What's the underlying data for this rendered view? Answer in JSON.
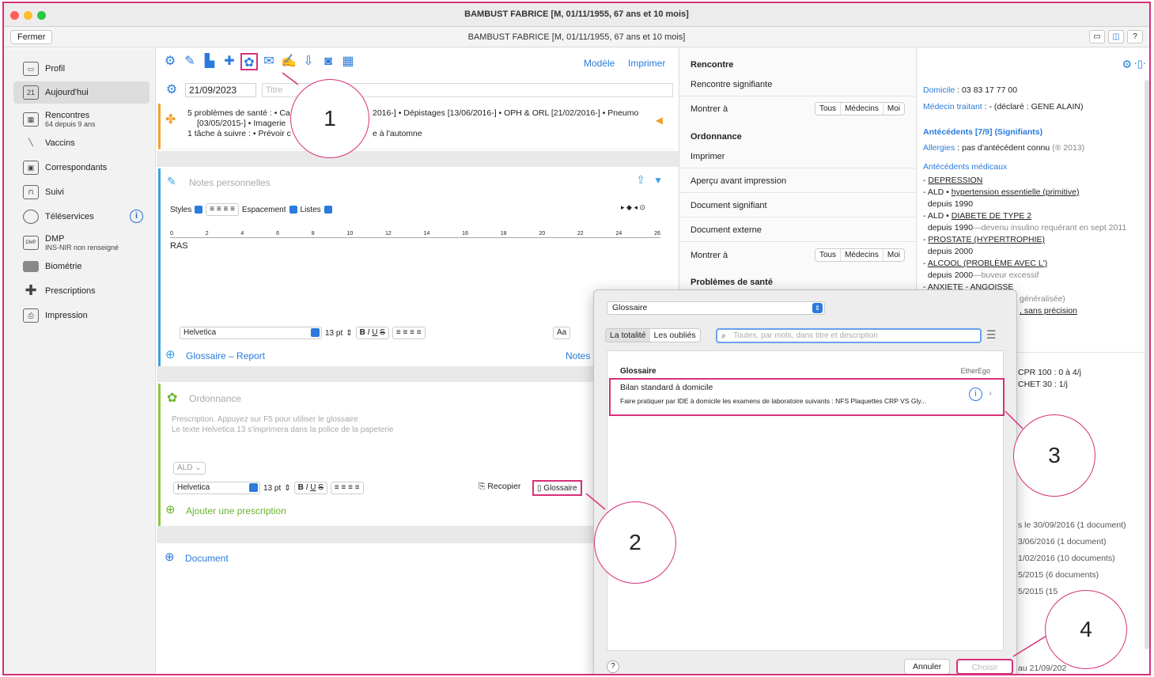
{
  "window": {
    "title": "BAMBUST FABRICE [M, 01/11/1955, 67 ans et 10 mois]",
    "subtitle": "BAMBUST FABRICE [M, 01/11/1955, 67 ans et 10 mois]",
    "close_label": "Fermer",
    "help_label": "?"
  },
  "sidebar": {
    "items": [
      {
        "label": "Profil",
        "sub": ""
      },
      {
        "label": "Aujourd'hui",
        "sub": ""
      },
      {
        "label": "Rencontres",
        "sub": "64 depuis 9 ans"
      },
      {
        "label": "Vaccins",
        "sub": ""
      },
      {
        "label": "Correspondants",
        "sub": ""
      },
      {
        "label": "Suivi",
        "sub": ""
      },
      {
        "label": "Téléservices",
        "sub": ""
      },
      {
        "label": "DMP",
        "sub": "INS-NIR non renseigné"
      },
      {
        "label": "Biométrie",
        "sub": ""
      },
      {
        "label": "Prescriptions",
        "sub": ""
      },
      {
        "label": "Impression",
        "sub": ""
      }
    ],
    "today_icon_text": "21"
  },
  "center": {
    "modele_label": "Modèle",
    "imprimer_label": "Imprimer",
    "date_value": "21/09/2023",
    "title_placeholder": "Titre",
    "problems_line1": "5 problèmes de santé : • Ca",
    "problems_line1b": "2016-] • Dépistages [13/06/2016-] • OPH & ORL [21/02/2016-] • Pneumo",
    "problems_line2": "[03/05/2015-] • Imagerie",
    "problems_line3": "1 tâche à suivre : • Prévoir c",
    "problems_line3b": "e à l'automne",
    "notes_placeholder": "Notes personnelles",
    "styles_label": "Styles",
    "espacement_label": "Espacement",
    "listes_label": "Listes",
    "notes_text": "RAS",
    "ruler_ticks": [
      "0",
      "2",
      "4",
      "6",
      "8",
      "10",
      "12",
      "14",
      "16",
      "18",
      "20",
      "22",
      "24",
      "26"
    ],
    "font_name": "Helvetica",
    "font_size": "13 pt",
    "fmt_b": "B",
    "fmt_i": "I",
    "fmt_u": "U",
    "fmt_s": "S",
    "aa_label": "Aa",
    "glossaire_report": "Glossaire  –  Report",
    "notes_link": "Notes",
    "ordonnance_label": "Ordonnance",
    "presc_hint1": "Prescription. Appuyez sur F5 pour utiliser le glossaire",
    "presc_hint2": "Le texte Helvetica 13 s'imprimera dans la police de la papeterie",
    "ald_label": "ALD ⌄",
    "recopier_label": "Recopier",
    "glossaire_label": "Glossaire",
    "add_prescription": "Ajouter une prescription",
    "document_label": "Document"
  },
  "right1": {
    "rencontre_head": "Rencontre",
    "rencontre_signifiante": "Rencontre signifiante",
    "montrer_a": "Montrer à",
    "seg": [
      "Tous",
      "Médecins",
      "Moi"
    ],
    "ordonnance_head": "Ordonnance",
    "imprimer": "Imprimer",
    "apercu": "Aperçu avant impression",
    "doc_signifiant": "Document signifiant",
    "doc_externe": "Document externe",
    "montrer_a2": "Montrer à",
    "problemes_head": "Problèmes de santé"
  },
  "right2": {
    "domicile_label": "Domicile",
    "domicile_value": " : 03 83 17 77 00",
    "medecin_label": "Médecin traitant",
    "medecin_value": " : - (déclaré : GENE ALAIN)",
    "antecedents_head": "Antécédents [7/9] (Signifiants)",
    "allergies_label": "Allergies",
    "allergies_value": " : pas d'antécédent connu",
    "allergies_year": " (® 2013)",
    "antecedents_medicaux": "Antécédents médicaux",
    "lines": [
      {
        "prefix": "- ",
        "u": "DEPRESSION",
        "rest": ""
      },
      {
        "prefix": "- ALD • ",
        "u": "hypertension essentielle (primitive)",
        "rest": ""
      },
      {
        "prefix": "  depuis 1990",
        "u": "",
        "rest": ""
      },
      {
        "prefix": "- ALD • ",
        "u": "DIABETE DE TYPE 2",
        "rest": ""
      },
      {
        "prefix": "  depuis 1990",
        "u": "",
        "rest": "—devenu insulino requérant en sept 2011"
      },
      {
        "prefix": "- ",
        "u": "PROSTATE (HYPERTROPHIE)",
        "rest": ""
      },
      {
        "prefix": "  depuis 2000",
        "u": "",
        "rest": ""
      },
      {
        "prefix": "- ",
        "u": "ALCOOL (PROBLÈME AVEC L')",
        "rest": ""
      },
      {
        "prefix": "  depuis 2000",
        "u": "",
        "rest": "—buveur excessif"
      },
      {
        "prefix": "- ",
        "u": "ANXIETE - ANGOISSE",
        "rest": ""
      }
    ],
    "partial1": "généralisée)",
    "partial2": ", sans précision",
    "crp": "CPR 100 : 0 à 4/j",
    "chet": "CHET 30 : 1/j",
    "docs": [
      "s le 30/09/2016 (1 document)",
      "3/06/2016 (1 document)",
      "1/02/2016 (10 documents)",
      "5/2015 (6 documents)",
      "5/2015 (15"
    ],
    "last_doc": "au 21/09/202"
  },
  "dialog": {
    "select_value": "Glossaire",
    "seg_all": "La totalité",
    "seg_forgot": "Les oubliés",
    "search_placeholder": "Toutes, par mots, dans titre et description",
    "group_head": "Glossaire",
    "group_right": "EtherEgo",
    "item_title": "Bilan standard à domicile",
    "item_desc": "Faire pratiquer par IDE à domicile les examens de laboratoire suivants : NFS Plaquettes CRP VS Gly...",
    "help": "?",
    "cancel": "Annuler",
    "choose": "Choisir"
  },
  "callouts": [
    "1",
    "2",
    "3",
    "4"
  ],
  "colors": {
    "accent": "#d6307a",
    "link": "#2a7bdc",
    "green": "#6ab42c",
    "orange": "#f0a030"
  }
}
